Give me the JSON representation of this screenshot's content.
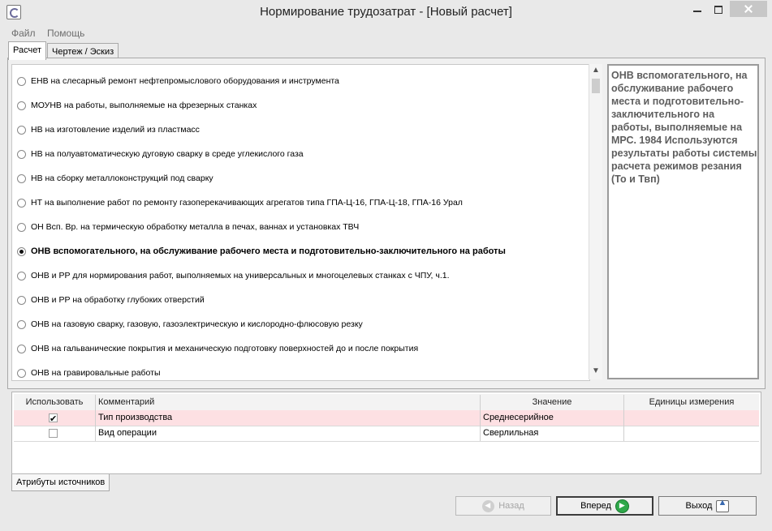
{
  "window": {
    "title": "Нормирование трудозатрат - [Новый расчет]"
  },
  "menu": {
    "items": [
      "Файл",
      "Помощь"
    ]
  },
  "tabs": {
    "top": [
      "Расчет",
      "Чертеж / Эскиз"
    ],
    "bottom": "Атрибуты источников"
  },
  "sources": {
    "selected_index": 7,
    "items": [
      "ЕНВ на слесарный ремонт нефтепромыслового оборудования и инструмента",
      "МОУНВ на работы, выполняемые на фрезерных станках",
      "НВ на изготовление изделий из пластмасс",
      "НВ на полуавтоматическую дуговую сварку в среде углекислого газа",
      "НВ на сборку металлоконструкций под сварку",
      "НТ на выполнение работ по ремонту газоперекачивающих агрегатов типа ГПА-Ц-16, ГПА-Ц-18, ГПА-16 Урал",
      "ОН Всп. Вр. на термическую обработку металла в печах, ваннах и установках ТВЧ",
      "ОНВ вспомогательного, на обслуживание рабочего места и подготовительно-заключительного на работы",
      "ОНВ и РР для нормирования работ, выполняемых на универсальных и многоцелевых станках с ЧПУ, ч.1.",
      "ОНВ и РР на обработку глубоких отверстий",
      "ОНВ на газовую сварку, газовую, газоэлектрическую и кислородно-флюсовую резку",
      "ОНВ на гальванические покрытия и механическую подготовку поверхностей до и после покрытия",
      "ОНВ на гравировальные работы"
    ]
  },
  "description": "ОНВ вспомогательного, на обслуживание рабочего места и подготовительно-заключительного на работы, выполняемые на МРС. 1984 Используются результаты работы системы расчета режимов резания (То и Твп)",
  "attributes": {
    "columns": [
      "Использовать",
      "Комментарий",
      "Значение",
      "Единицы измерения"
    ],
    "rows": [
      {
        "use": true,
        "comment": "Тип производства",
        "value": "Среднесерийное",
        "unit": ""
      },
      {
        "use": false,
        "comment": "Вид операции",
        "value": "Сверлильная",
        "unit": ""
      }
    ]
  },
  "buttons": {
    "back": "Назад",
    "forward": "Вперед",
    "exit": "Выход"
  },
  "colors": {
    "highlight_row": "#fde0e3",
    "forward_icon": "#2fa84a"
  }
}
